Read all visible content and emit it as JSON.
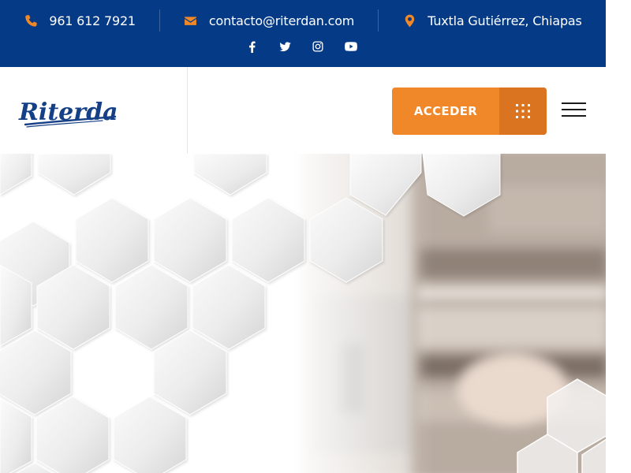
{
  "topbar": {
    "phone": {
      "icon": "phone-icon",
      "text": "961 612 7921"
    },
    "email": {
      "icon": "envelope-icon",
      "text": "contacto@riterdan.com"
    },
    "location": {
      "icon": "map-marker-icon",
      "text": "Tuxtla Gutiérrez, Chiapas"
    },
    "socials": [
      "facebook-icon",
      "twitter-icon",
      "instagram-icon",
      "youtube-icon"
    ]
  },
  "header": {
    "logo_text": "Riterdan",
    "access_label": "ACCEDER",
    "access_icon": "grid-dots-icon",
    "menu_icon": "hamburger-menu-icon"
  },
  "colors": {
    "topbar_bg": "#053A86",
    "accent": "#F0882A",
    "accent_dark": "#DB7420",
    "logo_blue": "#153F86"
  }
}
